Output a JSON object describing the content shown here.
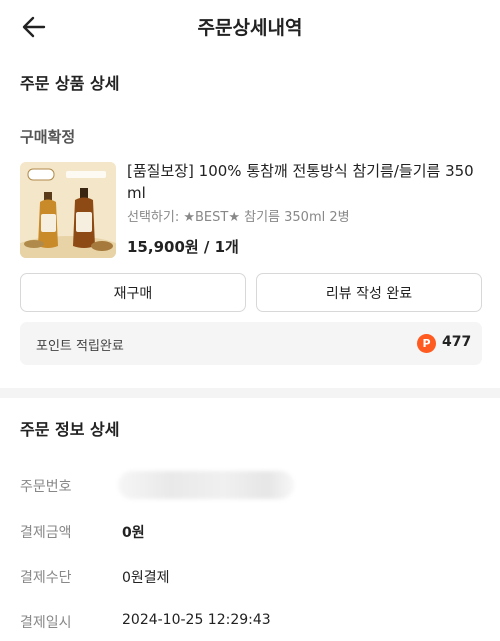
{
  "header": {
    "title": "주문상세내역",
    "back_icon": "arrow-left-icon"
  },
  "order_products": {
    "section_title": "주문 상품 상세",
    "status": "구매확정",
    "product": {
      "name": "[품질보장] 100% 통참깨 전통방식 참기름/들기름 350ml",
      "option": "선택하기: ★BEST★ 참기름 350ml 2병",
      "price": "15,900원 / 1개"
    },
    "buttons": {
      "rebuy": "재구매",
      "review": "리뷰 작성 완료"
    },
    "points": {
      "label": "포인트 적립완료",
      "icon_text": "P",
      "value": "477",
      "icon_color": "#ff5a1f"
    }
  },
  "order_info": {
    "section_title": "주문 정보 상세",
    "rows": [
      {
        "label": "주문번호",
        "value": ""
      },
      {
        "label": "결제금액",
        "value": "0원"
      },
      {
        "label": "결제수단",
        "value": "0원결제"
      },
      {
        "label": "결제일시",
        "value": "2024-10-25 12:29:43"
      }
    ]
  }
}
